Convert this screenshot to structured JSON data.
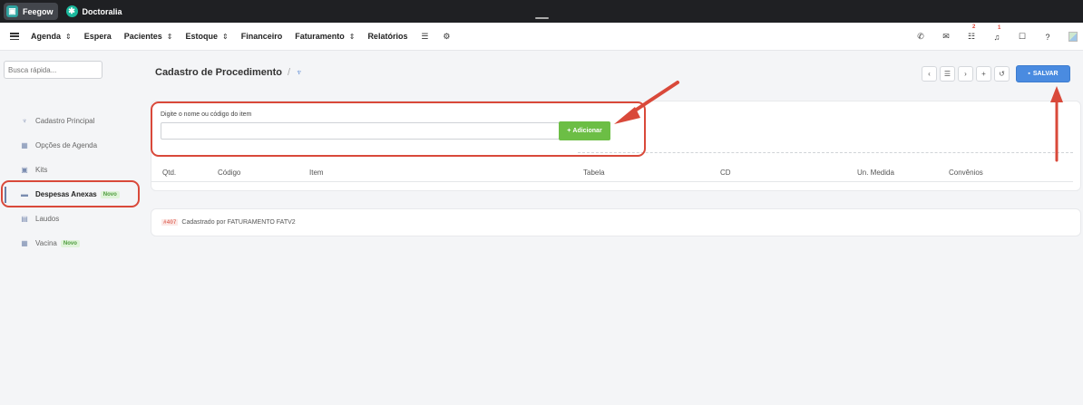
{
  "appbar": {
    "tabs": [
      {
        "label": "Feegow",
        "icon": "feegow-logo"
      },
      {
        "label": "Doctoralia",
        "icon": "doctoralia-logo"
      }
    ]
  },
  "nav": {
    "items": [
      {
        "label": "Agenda",
        "dropdown": true
      },
      {
        "label": "Espera",
        "dropdown": false
      },
      {
        "label": "Pacientes",
        "dropdown": true
      },
      {
        "label": "Estoque",
        "dropdown": true
      },
      {
        "label": "Financeiro",
        "dropdown": false
      },
      {
        "label": "Faturamento",
        "dropdown": true
      },
      {
        "label": "Relatórios",
        "dropdown": false
      }
    ],
    "icons_right": [
      {
        "name": "phone-icon",
        "badge": ""
      },
      {
        "name": "inbox-icon",
        "badge": ""
      },
      {
        "name": "tasks-icon",
        "badge": "2"
      },
      {
        "name": "bell-icon",
        "badge": "1"
      },
      {
        "name": "chat-icon",
        "badge": ""
      },
      {
        "name": "help-icon",
        "badge": ""
      }
    ]
  },
  "search": {
    "placeholder": "Busca rápida..."
  },
  "sidebar": {
    "items": [
      {
        "label": "Cadastro Principal",
        "icon": "stethoscope-icon",
        "novo": ""
      },
      {
        "label": "Opções de Agenda",
        "icon": "calendar-icon",
        "novo": ""
      },
      {
        "label": "Kits",
        "icon": "kit-icon",
        "novo": ""
      },
      {
        "label": "Despesas Anexas",
        "icon": "credit-card-icon",
        "novo": "Novo"
      },
      {
        "label": "Laudos",
        "icon": "document-icon",
        "novo": ""
      },
      {
        "label": "Vacina",
        "icon": "calendar-icon",
        "novo": "Novo"
      }
    ]
  },
  "header": {
    "title": "Cadastro de Procedimento",
    "save_label": "SALVAR"
  },
  "form": {
    "field_label": "Digite o nome ou código do item",
    "add_label": "Adicionar",
    "columns": [
      "Qtd.",
      "Código",
      "Item",
      "Tabela",
      "CD",
      "Un. Medida",
      "Convênios"
    ]
  },
  "info": {
    "code": "#407",
    "text": "Cadastrado por FATURAMENTO FATV2"
  },
  "colors": {
    "accent": "#4a8be0",
    "add_button": "#6cbe45",
    "annotation": "#d9493a"
  }
}
